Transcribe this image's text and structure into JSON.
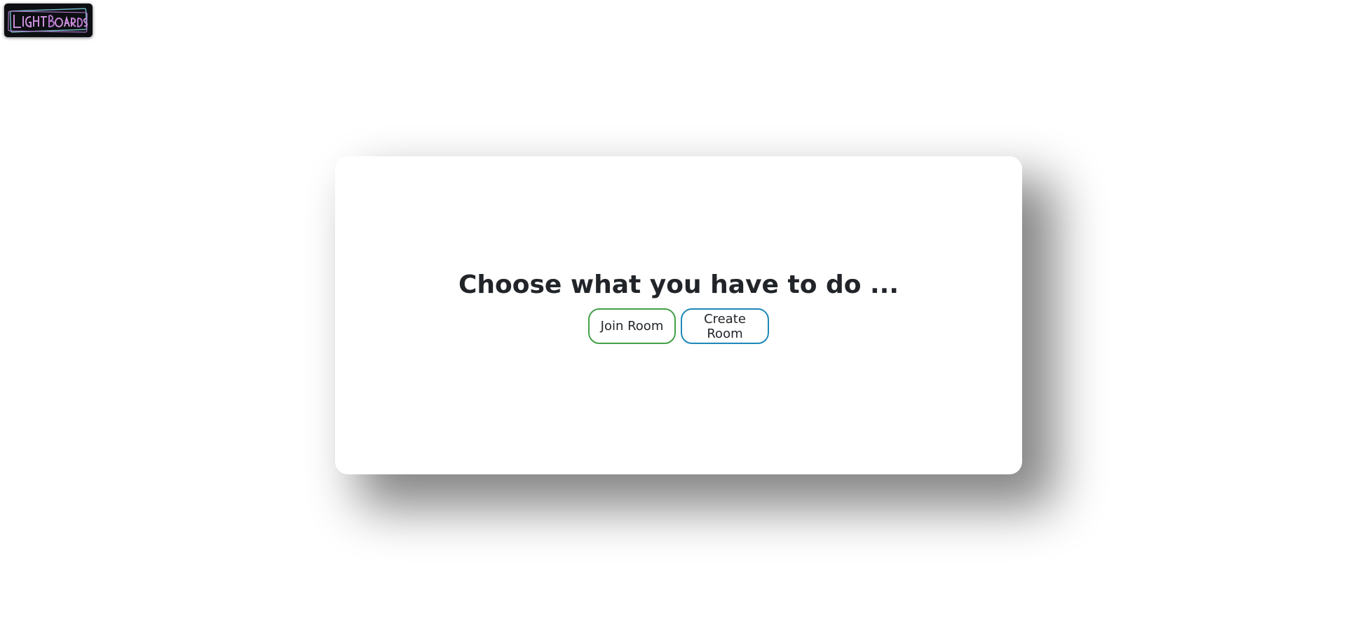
{
  "logo": {
    "alt": "Lightboards logo",
    "icon": "neon-logo-icon"
  },
  "main": {
    "heading": "Choose what you have to do ...",
    "buttons": {
      "join_label": "Join Room",
      "create_label": "Create Room"
    }
  },
  "colors": {
    "join_border": "#43a047",
    "create_border": "#1e88b8",
    "text": "#212529",
    "logo_bg": "#0d0f12"
  }
}
